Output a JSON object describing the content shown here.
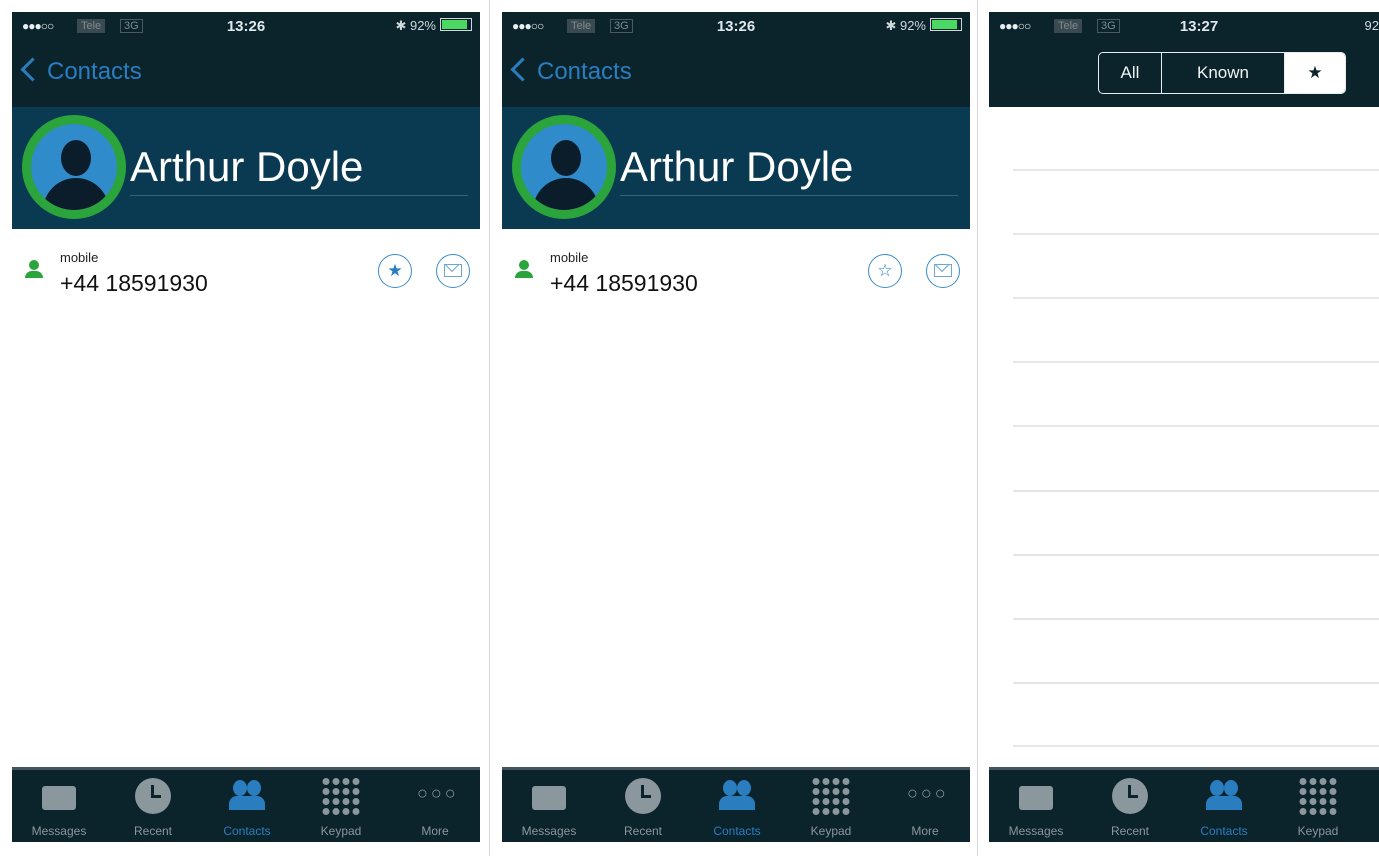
{
  "status": {
    "signal": "●●●○○",
    "carrier": "Tele",
    "network": "3G",
    "battery": "92%",
    "bluetooth": "✱"
  },
  "screens": [
    {
      "time": "13:26",
      "back_label": "Contacts",
      "contact_name": "Arthur Doyle",
      "number_type": "mobile",
      "number": "+44 18591930",
      "favorite": true,
      "favorite_icon": "★"
    },
    {
      "time": "13:26",
      "back_label": "Contacts",
      "contact_name": "Arthur Doyle",
      "number_type": "mobile",
      "number": "+44 18591930",
      "favorite": false,
      "favorite_icon": "☆"
    },
    {
      "time": "13:27",
      "battery": "92"
    }
  ],
  "filter": {
    "all": "All",
    "known": "Known",
    "star": "★"
  },
  "tabs": [
    {
      "label": "Messages",
      "icon": "envelope-icon"
    },
    {
      "label": "Recent",
      "icon": "clock-icon"
    },
    {
      "label": "Contacts",
      "icon": "contacts-icon",
      "active": true
    },
    {
      "label": "Keypad",
      "icon": "keypad-icon"
    },
    {
      "label": "More",
      "icon": "more-icon",
      "glyph": "○○○"
    }
  ],
  "colors": {
    "accent": "#2a7ec0",
    "online_green": "#2aa43b",
    "nav_bg": "#0b232b",
    "header_bg": "#093a52"
  }
}
